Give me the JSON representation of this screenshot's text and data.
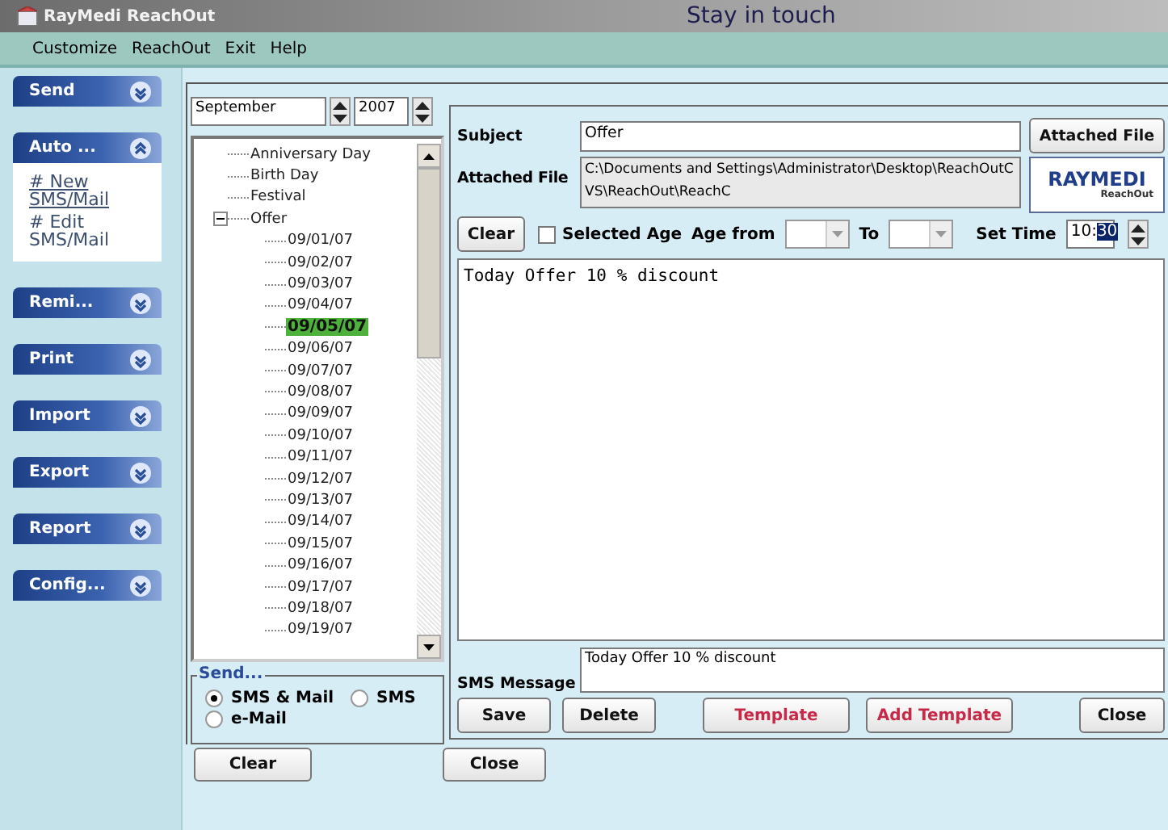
{
  "window": {
    "title": "RayMedi ReachOut",
    "banner": "Stay in touch"
  },
  "menu": [
    {
      "label": "Customize"
    },
    {
      "label": "ReachOut"
    },
    {
      "label": "Exit"
    },
    {
      "label": "Help"
    }
  ],
  "sidebar": {
    "sections": [
      {
        "label": "Send",
        "expanded": false
      },
      {
        "label": "Auto ...",
        "expanded": true,
        "links": [
          "# New SMS/Mail",
          "# Edit SMS/Mail"
        ]
      },
      {
        "label": "Remi...",
        "expanded": false
      },
      {
        "label": "Print",
        "expanded": false
      },
      {
        "label": "Import",
        "expanded": false
      },
      {
        "label": "Export",
        "expanded": false
      },
      {
        "label": "Report",
        "expanded": false
      },
      {
        "label": "Config...",
        "expanded": false
      }
    ]
  },
  "date_picker": {
    "month": "September",
    "year": "2007"
  },
  "tree": [
    {
      "label": "Anniversary Day",
      "selected": false
    },
    {
      "label": "Birth Day",
      "selected": false
    },
    {
      "label": "Festival",
      "selected": false
    },
    {
      "label": "Offer",
      "selected": false,
      "expanded": true,
      "children": [
        {
          "label": "09/01/07",
          "selected": false
        },
        {
          "label": "09/02/07",
          "selected": false
        },
        {
          "label": "09/03/07",
          "selected": false
        },
        {
          "label": "09/04/07",
          "selected": false
        },
        {
          "label": "09/05/07",
          "selected": true
        },
        {
          "label": "09/06/07",
          "selected": false
        },
        {
          "label": "09/07/07",
          "selected": false
        },
        {
          "label": "09/08/07",
          "selected": false
        },
        {
          "label": "09/09/07",
          "selected": false
        },
        {
          "label": "09/10/07",
          "selected": false
        },
        {
          "label": "09/11/07",
          "selected": false
        },
        {
          "label": "09/12/07",
          "selected": false
        },
        {
          "label": "09/13/07",
          "selected": false
        },
        {
          "label": "09/14/07",
          "selected": false
        },
        {
          "label": "09/15/07",
          "selected": false
        },
        {
          "label": "09/16/07",
          "selected": false
        },
        {
          "label": "09/17/07",
          "selected": false
        },
        {
          "label": "09/18/07",
          "selected": false
        },
        {
          "label": "09/19/07",
          "selected": false
        }
      ]
    }
  ],
  "send_group": {
    "title": "Send...",
    "options": [
      {
        "label": "SMS & Mail",
        "selected": true
      },
      {
        "label": "SMS",
        "selected": false
      },
      {
        "label": "e-Mail",
        "selected": false
      }
    ]
  },
  "left_clear_button": "Clear",
  "form": {
    "subject_label": "Subject",
    "subject": "Offer",
    "attached_file_button": "Attached File",
    "attached_file_label": "Attached File",
    "attached_file": "C:\\Documents and Settings\\Administrator\\Desktop\\ReachOutCVS\\ReachOut\\ReachC",
    "logo": {
      "name": "RAYMEDI",
      "sub": "ReachOut"
    },
    "clear_button": "Clear",
    "selected_age": {
      "label": "Selected Age",
      "checked": false
    },
    "age_from_label": "Age from",
    "to_label": "To",
    "set_time_label": "Set Time",
    "set_time": {
      "hours": "10",
      "separator": ":",
      "minutes": "30",
      "minutes_selected": true
    },
    "message": "Today Offer 10 % discount",
    "sms_label": "SMS Message",
    "sms_message": "Today Offer 10 % discount",
    "buttons": [
      {
        "label": "Save",
        "kind": "plain"
      },
      {
        "label": "Delete",
        "kind": "plain"
      },
      {
        "label": "Template",
        "kind": "accent"
      },
      {
        "label": "Add Template",
        "kind": "accent"
      },
      {
        "label": "Close",
        "kind": "plain"
      }
    ]
  },
  "close_button": "Close"
}
